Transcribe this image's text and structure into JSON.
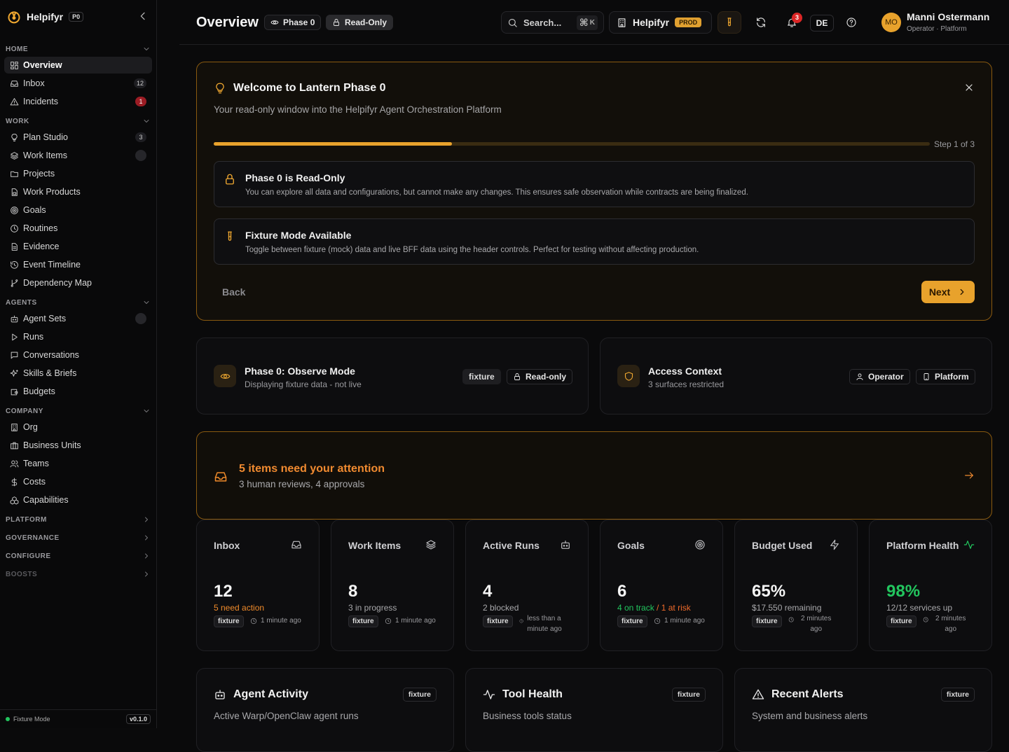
{
  "sidebar": {
    "brand": "Helpifyr",
    "brand_tag": "P0",
    "sections": {
      "home": "HOME",
      "work": "WORK",
      "agents": "AGENTS",
      "company": "COMPANY",
      "platform": "PLATFORM",
      "governance": "GOVERNANCE",
      "configure": "CONFIGURE",
      "boosts": "BOOSTS"
    },
    "items": {
      "overview": "Overview",
      "inbox": "Inbox",
      "inbox_count": "12",
      "incidents": "Incidents",
      "incidents_count": "1",
      "plan_studio": "Plan Studio",
      "plan_studio_count": "3",
      "work_items": "Work Items",
      "projects": "Projects",
      "work_products": "Work Products",
      "goals": "Goals",
      "routines": "Routines",
      "evidence": "Evidence",
      "event_timeline": "Event Timeline",
      "dependency_map": "Dependency Map",
      "agent_sets": "Agent Sets",
      "runs": "Runs",
      "conversations": "Conversations",
      "skills_briefs": "Skills & Briefs",
      "budgets": "Budgets",
      "org": "Org",
      "business_units": "Business Units",
      "teams": "Teams",
      "costs": "Costs",
      "capabilities": "Capabilities"
    },
    "footer": {
      "mode": "Fixture Mode",
      "version": "v0.1.0"
    }
  },
  "header": {
    "title": "Overview",
    "phase_badge": "Phase 0",
    "readonly_badge": "Read-Only",
    "search_placeholder": "Search...",
    "search_kbd": "⌘",
    "search_key": "K",
    "tenant": "Helpifyr",
    "env": "PROD",
    "notif_count": "3",
    "lang": "DE",
    "user_initials": "MO",
    "user_name": "Manni Ostermann",
    "user_role": "Operator · Platform"
  },
  "welcome": {
    "title": "Welcome to Lantern Phase 0",
    "subtitle": "Your read-only window into the Helpifyr Agent Orchestration Platform",
    "progress": 0.333,
    "step": "Step 1 of 3",
    "note1_title": "Phase 0 is Read-Only",
    "note1_desc": "You can explore all data and configurations, but cannot make any changes. This ensures safe observation while contracts are being finalized.",
    "note2_title": "Fixture Mode Available",
    "note2_desc": "Toggle between fixture (mock) data and live BFF data using the header controls. Perfect for testing without affecting production.",
    "back": "Back",
    "next": "Next"
  },
  "observe": {
    "title": "Phase 0: Observe Mode",
    "desc": "Displaying fixture data - not live",
    "chip1": "fixture",
    "chip2": "Read-only"
  },
  "access": {
    "title": "Access Context",
    "desc": "3 surfaces restricted",
    "chip1": "Operator",
    "chip2": "Platform"
  },
  "attention": {
    "title": "5 items need your attention",
    "desc": "3 human reviews, 4 approvals"
  },
  "stats": {
    "inbox": {
      "label": "Inbox",
      "value": "12",
      "sub": "5 need action",
      "tag": "fixture",
      "time": "1 minute ago"
    },
    "work": {
      "label": "Work Items",
      "value": "8",
      "sub": "3 in progress",
      "tag": "fixture",
      "time": "1 minute ago"
    },
    "runs": {
      "label": "Active Runs",
      "value": "4",
      "sub": "2 blocked",
      "tag": "fixture",
      "time": "less than a minute ago"
    },
    "goals": {
      "label": "Goals",
      "value": "6",
      "sub_on": "4 on track",
      "sub_sep": " / ",
      "sub_risk": "1 at risk",
      "tag": "fixture",
      "time": "1 minute ago"
    },
    "budget": {
      "label": "Budget Used",
      "value": "65%",
      "sub": "$17.550 remaining",
      "tag": "fixture",
      "time": "2 minutes ago"
    },
    "health": {
      "label": "Platform Health",
      "value": "98%",
      "sub": "12/12 services up",
      "tag": "fixture",
      "time": "2 minutes ago"
    }
  },
  "panels": {
    "agent": {
      "title": "Agent Activity",
      "desc": "Active Warp/OpenClaw agent runs",
      "tag": "fixture"
    },
    "tool": {
      "title": "Tool Health",
      "desc": "Business tools status",
      "tag": "fixture"
    },
    "alerts": {
      "title": "Recent Alerts",
      "desc": "System and business alerts",
      "tag": "fixture"
    }
  },
  "colors": {
    "accent": "#e8a22c",
    "attention": "#ef8a2a",
    "success": "#22c55e",
    "danger": "#dc2626"
  }
}
